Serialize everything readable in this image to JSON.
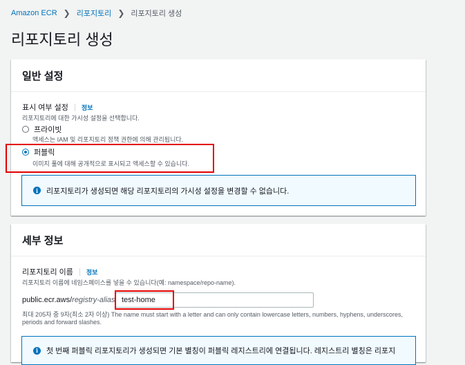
{
  "breadcrumb": {
    "items": [
      "Amazon ECR",
      "리포지토리",
      "리포지토리 생성"
    ]
  },
  "page": {
    "title": "리포지토리 생성"
  },
  "general": {
    "header": "일반 설정",
    "visibility": {
      "label": "표시 여부 설정",
      "info": "정보",
      "description": "리포지토리에 대한 가시성 설정을 선택합니다.",
      "options": [
        {
          "label": "프라이빗",
          "description": "액세스는 IAM 및 리포지토리 정책 권한에 의해 관리됩니다.",
          "selected": false
        },
        {
          "label": "퍼블릭",
          "description": "이미지 풀에 대해 공개적으로 표시되고 액세스할 수 있습니다.",
          "selected": true
        }
      ]
    },
    "alert": "리포지토리가 생성되면 해당 리포지토리의 가시성 설정을 변경할 수 없습니다."
  },
  "details": {
    "header": "세부 정보",
    "repo_name": {
      "label": "리포지토리 이름",
      "info": "정보",
      "description": "리포지토리 이름에 네임스페이스를 넣을 수 있습니다(예: namespace/repo-name).",
      "prefix": "public.ecr.aws/",
      "alias": "registry-alias",
      "slash": "/",
      "value": "test-home",
      "constraint": "최대 205자 중 9자(최소 2자 이상) The name must start with a letter and can only contain lowercase letters, numbers, hyphens, underscores, periods and forward slashes."
    },
    "alert": "첫 번째 퍼블릭 리포지토리가 생성되면 기본 별칭이 퍼블릭 레지스트리에 연결됩니다. 레지스트리 별칭은 리포지"
  },
  "colors": {
    "link": "#0073bb",
    "highlight": "#e30000",
    "alert_bg": "#f1faff"
  }
}
